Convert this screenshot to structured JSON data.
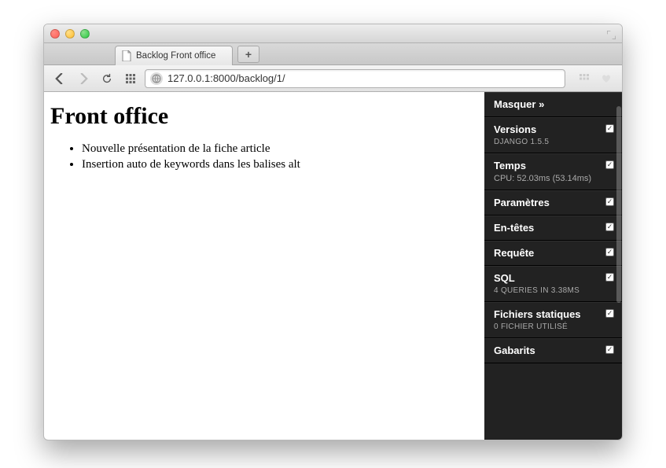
{
  "browser": {
    "tab_title": "Backlog Front office",
    "url": "127.0.0.1:8000/backlog/1/",
    "new_tab_label": "+"
  },
  "page": {
    "heading": "Front office",
    "items": [
      "Nouvelle présentation de la fiche article",
      "Insertion auto de keywords dans les balises alt"
    ]
  },
  "debug": {
    "hide_label": "Masquer »",
    "panels": [
      {
        "title": "Versions",
        "sub": "Django 1.5.5",
        "checked": true
      },
      {
        "title": "Temps",
        "sub": "CPU: 52.03ms (53.14ms)",
        "checked": true,
        "sub_normal": true
      },
      {
        "title": "Paramètres",
        "checked": true
      },
      {
        "title": "En-têtes",
        "checked": true
      },
      {
        "title": "Requête",
        "checked": true
      },
      {
        "title": "SQL",
        "sub": "4 queries in 3.38ms",
        "checked": true
      },
      {
        "title": "Fichiers statiques",
        "sub": "0 fichier utilisé",
        "checked": true
      },
      {
        "title": "Gabarits",
        "checked": true
      }
    ]
  }
}
